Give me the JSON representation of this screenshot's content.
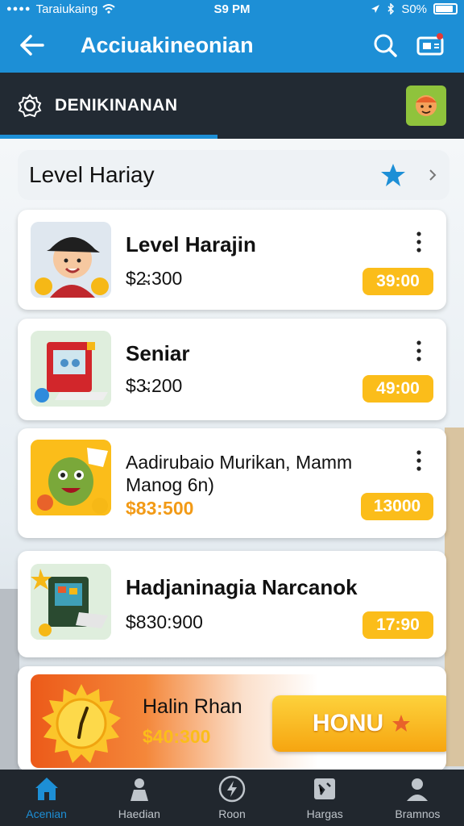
{
  "status_bar": {
    "carrier": "Taraiukaing",
    "time": "S9 PM",
    "battery": "S0%"
  },
  "app_bar": {
    "title": "Acciuakineonian"
  },
  "banner": {
    "title": "DENIKINANAN"
  },
  "section": {
    "title": "Level Hariay"
  },
  "items": [
    {
      "name": "Level Harajin",
      "price": "$2̴:300",
      "badge": "39:00"
    },
    {
      "name": "Seniar",
      "price": "$3̴:200",
      "badge": "49:00"
    },
    {
      "name": "Aadirubaio Murikan, Mamm Manog 6n)",
      "price": "$83:500",
      "badge": "13000"
    },
    {
      "name": "Hadjaninagia Narcanok",
      "price": "$830:900",
      "badge": "17:90"
    }
  ],
  "promo": {
    "name": "Halin Rhan",
    "price": "$40:300",
    "button_label": "HONU"
  },
  "bottom_nav": [
    {
      "label": "Acenian",
      "icon": "home-icon"
    },
    {
      "label": "Haedian",
      "icon": "person-icon"
    },
    {
      "label": "Roon",
      "icon": "lightning-icon"
    },
    {
      "label": "Hargas",
      "icon": "card-icon"
    },
    {
      "label": "Bramnos",
      "icon": "profile-icon"
    }
  ],
  "colors": {
    "primary": "#1d8fd6",
    "banner_dark": "#222a33",
    "badge_yellow": "#fbbd1a",
    "promo_orange": "#ec5a19",
    "nav_dark": "#21272e"
  }
}
